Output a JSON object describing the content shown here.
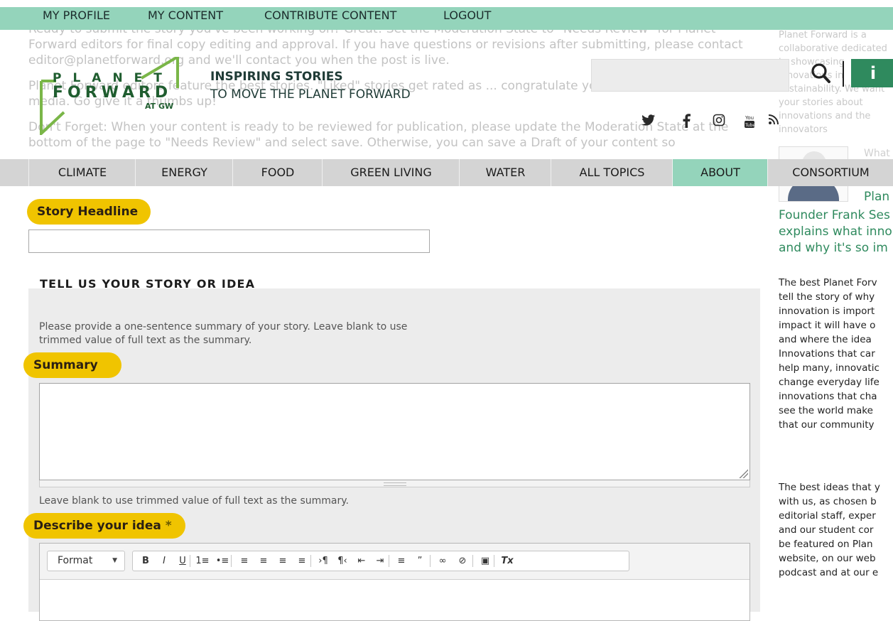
{
  "background": {
    "paragraphs": [
      "Ready to submit the story you've been working on? Great! Set the Moderation State to \"Needs Review\" for Planet Forward editors for final copy editing and approval. If you have questions or revisions after submitting, please contact editor@planetforward.org and we'll contact you when the post is live.",
      "Planet Forward editors feature the best stories. \"Liked\" stories get rated as ... congratulate your contributions in social media. Go give it a thumbs up!",
      "Don't Forget: When your content is ready to be reviewed for publication, please update the Moderation State at the bottom of the page to \"Needs Review\" and select save. Otherwise, you can save a Draft of your content so"
    ],
    "right_intro": "Planet Forward is a collaborative dedicated to showcasing innovations in sustainability. We want your stories about innovations and the innovators",
    "card_heading": "What"
  },
  "topbar": {
    "links": [
      "MY PROFILE",
      "MY CONTENT",
      "CONTRIBUTE CONTENT",
      "LOGOUT"
    ]
  },
  "header": {
    "logo_planet": "PLANET",
    "logo_forward": "FORWARD",
    "logo_atgw": "AT GW",
    "tagline_bold": "INSPIRING STORIES",
    "tagline_rest": "TO MOVE THE PLANET FORWARD",
    "info_label": "i",
    "social_icons": [
      "twitter-icon",
      "facebook-icon",
      "instagram-icon",
      "youtube-icon",
      "rss-icon"
    ],
    "social_glyphs": [
      "→",
      "f",
      "◎",
      "▣",
      "≡"
    ]
  },
  "mainnav": {
    "items": [
      "CLIMATE",
      "ENERGY",
      "FOOD",
      "GREEN LIVING",
      "WATER",
      "ALL TOPICS",
      "ABOUT",
      "CONSORTIUM"
    ]
  },
  "sidebar": {
    "video_title_1": "Plan",
    "video_title_lines": [
      "Founder Frank Ses",
      "explains what inno",
      "and why it's so im"
    ],
    "para1": [
      "The best Planet Forv",
      "tell the story of why",
      "innovation is import",
      "impact it will have o",
      "and where the idea",
      "Innovations that car",
      "help many, innovatic",
      "change everyday life",
      "innovations that cha",
      "see the world make",
      "that our community"
    ],
    "para2": [
      "The best ideas that y",
      "with us, as chosen b",
      "editorial staff, exper",
      "and our student cor",
      "be featured on Plan",
      "website, on our web",
      "podcast and at our e"
    ]
  },
  "form": {
    "headline_label": "Story Headline",
    "required_mark": "*",
    "section_title": "TELL US YOUR STORY OR IDEA",
    "summary_help": "Please provide a one-sentence summary of your story. Leave blank to use trimmed value of full text as the summary.",
    "summary_label": "Summary",
    "summary_note": "Leave blank to use trimmed value of full text as the summary.",
    "describe_label": "Describe your idea"
  },
  "editor": {
    "format_label": "Format",
    "tools": [
      "B",
      "I",
      "U",
      "1≡",
      "•≡",
      "≡",
      "≡",
      "≡",
      "≡",
      "›¶",
      "¶‹",
      "⇤",
      "⇥",
      "≡",
      "”",
      "∞",
      "⊘",
      "▣",
      "Tx"
    ],
    "tool_names": [
      "bold-button",
      "italic-button",
      "underline-button",
      "numbered-list-button",
      "bulleted-list-button",
      "align-left-button",
      "align-center-button",
      "align-right-button",
      "justify-button",
      "ltr-button",
      "rtl-button",
      "outdent-button",
      "indent-button",
      "horizontal-rule-button",
      "blockquote-button",
      "link-button",
      "unlink-button",
      "image-button",
      "remove-format-button"
    ]
  },
  "colors": {
    "topbar": "#94d4bb",
    "pill": "#f0c400",
    "brand_green": "#2f8a5e",
    "sidebar_link": "#2f8a5e"
  }
}
